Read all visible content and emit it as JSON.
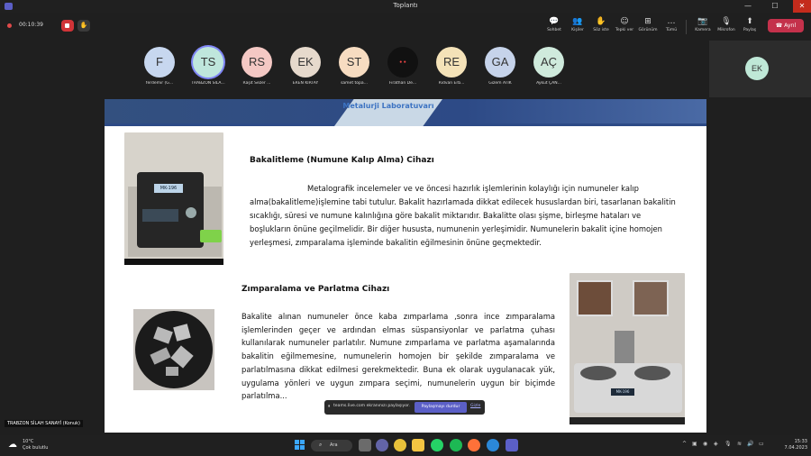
{
  "window": {
    "title": "Toplantı",
    "minimize": "—",
    "maximize": "☐",
    "close": "✕"
  },
  "toolbar": {
    "timer": "00:10:39",
    "buttons": [
      {
        "icon": "💬",
        "label": "Sohbet"
      },
      {
        "icon": "👥",
        "label": "Kişiler"
      },
      {
        "icon": "✋",
        "label": "Söz iste"
      },
      {
        "icon": "☺",
        "label": "Tepki ver"
      },
      {
        "icon": "⊞",
        "label": "Görünüm"
      },
      {
        "icon": "…",
        "label": "Tümü"
      },
      {
        "icon": "📷",
        "label": "Kamera"
      },
      {
        "icon": "🎙",
        "label": "Mikrofon"
      },
      {
        "icon": "⬆",
        "label": "Paylaş"
      }
    ],
    "leave_label": "Ayrıl"
  },
  "participants": [
    {
      "initials": "F",
      "name": "ferdemir (G...",
      "color": "#c7d7ef"
    },
    {
      "initials": "TS",
      "name": "TRABZON SİLA...",
      "color": "#bfe6dc"
    },
    {
      "initials": "RS",
      "name": "Raşit Sezer ...",
      "color": "#f4c8c4"
    },
    {
      "initials": "EK",
      "name": "EREN KIRTAY",
      "color": "#e6d9cc"
    },
    {
      "initials": "ST",
      "name": "samet topa...",
      "color": "#f7dcc1"
    },
    {
      "initials": "",
      "name": "Firathan De...",
      "color": "#111111"
    },
    {
      "initials": "RE",
      "name": "Rıdvan Erb...",
      "color": "#f4e2b8"
    },
    {
      "initials": "GA",
      "name": "Gizem ATİK",
      "color": "#c6d3ea"
    },
    {
      "initials": "AÇ",
      "name": "Aykut ÇAN...",
      "color": "#cfeadc"
    }
  ],
  "self_tile": {
    "initials": "EK"
  },
  "slide": {
    "banner": "Metalurji Laboratuvarı",
    "heading1": "Bakalitleme (Numune Kalıp Alma) Cihazı",
    "para1": "Metalografik incelemeler ve ve öncesi hazırlık işlemlerinin kolaylığı için numuneler kalıp alma(bakalitleme)işlemine tabi tutulur. Bakalit hazırlamada dikkat edilecek hususlardan biri, tasarlanan bakalitin sıcaklığı, süresi ve numune kalınlığına göre bakalit miktarıdır. Bakalitte olası şişme, birleşme hataları ve boşlukların önüne geçilmelidir. Bir diğer hususta, numunenin yerleşimidir. Numunelerin bakalit içine homojen yerleşmesi, zımparalama işleminde bakalitin eğilmesinin önüne geçmektedir.",
    "heading2": "Zımparalama ve Parlatma Cihazı",
    "para2": "Bakalite alınan numuneler önce kaba zımparlama ,sonra ince zımparalama işlemlerinden geçer ve ardından elmas süspansiyonlar ve parlatma çuhası kullanılarak numuneler parlatılır. Numune zımparlama ve parlatma aşamalarında bakalitin eğilmemesine, numunelerin homojen bir şekilde zımparalama ve parlatılmasına dikkat edilmesi gerekmektedir. Buna ek olarak uygulanacak yük, uygulama yönleri ve uygun zımpara seçimi, numunelerin uygun bir biçimde parlatılma...",
    "device1_label": "MK-196",
    "device2_label": "MK-196"
  },
  "sharebar": {
    "text": "teams.live.com ekranınızı paylaşıyor.",
    "stop_label": "Paylaşmayı durdur",
    "hide_label": "Gizle"
  },
  "presenter_label": "TRABZON SİLAH SANAYİ (Konuk)",
  "taskbar": {
    "weather_temp": "10°C",
    "weather_desc": "Çok bulutlu",
    "search_label": "Ara",
    "time": "15:33",
    "date": "7.04.2023"
  }
}
